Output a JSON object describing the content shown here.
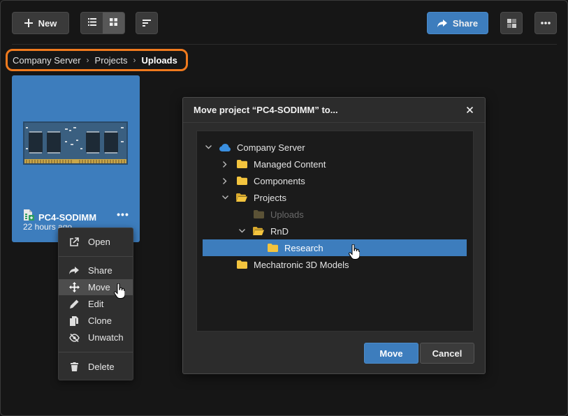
{
  "toolbar": {
    "new_label": "New",
    "share_label": "Share",
    "view_mode": "grid",
    "accent_color": "#3d7dbd"
  },
  "breadcrumb": {
    "items": [
      "Company Server",
      "Projects",
      "Uploads"
    ],
    "highlight_color": "#f07a1e"
  },
  "card": {
    "title": "PC4-SODIMM",
    "subtitle": "22 hours ago",
    "more_label": "•••"
  },
  "context_menu": {
    "items": [
      {
        "label": "Open",
        "icon": "open-external-icon"
      },
      {
        "label": "Share",
        "icon": "share-arrow-icon"
      },
      {
        "label": "Move",
        "icon": "move-arrows-icon",
        "hovered": true
      },
      {
        "label": "Edit",
        "icon": "pencil-icon"
      },
      {
        "label": "Clone",
        "icon": "clone-icon"
      },
      {
        "label": "Unwatch",
        "icon": "eye-off-icon"
      },
      {
        "label": "Delete",
        "icon": "trash-icon"
      }
    ]
  },
  "dialog": {
    "title": "Move project “PC4-SODIMM” to...",
    "tree": [
      {
        "label": "Company Server",
        "icon": "cloud-icon",
        "expanded": true,
        "depth": 0
      },
      {
        "label": "Managed Content",
        "icon": "folder-icon",
        "expanded": false,
        "depth": 1
      },
      {
        "label": "Components",
        "icon": "folder-icon",
        "expanded": false,
        "depth": 1
      },
      {
        "label": "Projects",
        "icon": "folder-open-icon",
        "expanded": true,
        "depth": 1
      },
      {
        "label": "Uploads",
        "icon": "folder-icon",
        "disabled": true,
        "depth": 2
      },
      {
        "label": "RnD",
        "icon": "folder-open-icon",
        "expanded": true,
        "depth": 2
      },
      {
        "label": "Research",
        "icon": "folder-icon",
        "selected": true,
        "depth": 3
      },
      {
        "label": "Mechatronic 3D Models",
        "icon": "folder-icon",
        "depth": 1
      }
    ],
    "move_label": "Move",
    "cancel_label": "Cancel"
  }
}
